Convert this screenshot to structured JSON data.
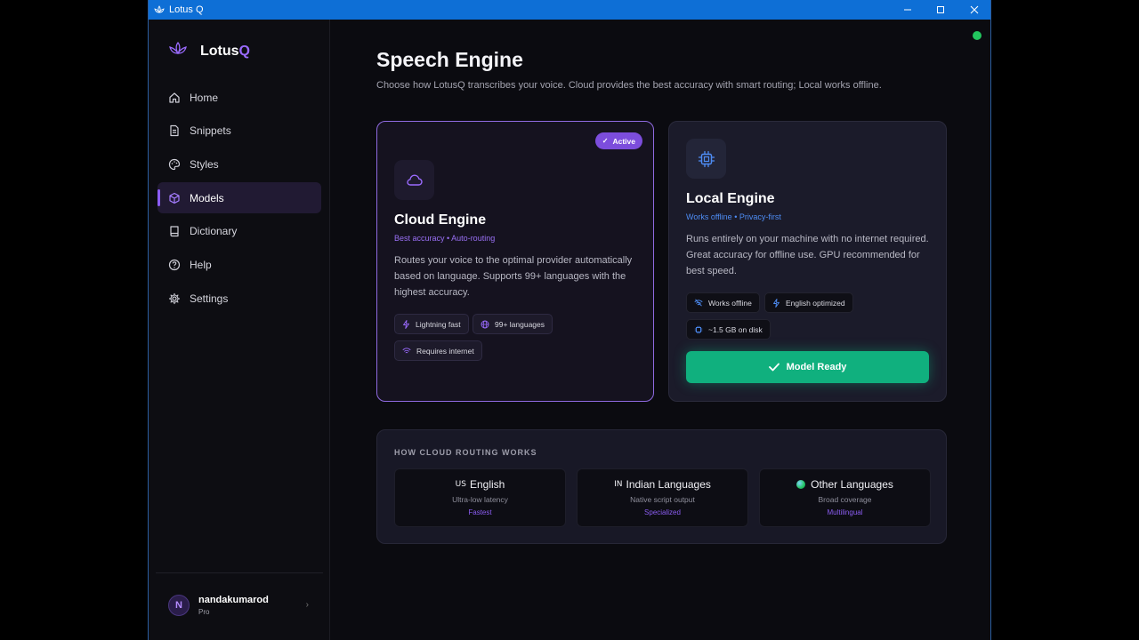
{
  "window": {
    "title": "Lotus Q",
    "controls": [
      "minimize",
      "maximize",
      "close"
    ]
  },
  "brand": {
    "name_main": "Lotus",
    "name_accent": "Q"
  },
  "sidebar": {
    "items": [
      {
        "label": "Home",
        "icon": "home-icon",
        "active": false
      },
      {
        "label": "Snippets",
        "icon": "document-icon",
        "active": false
      },
      {
        "label": "Styles",
        "icon": "palette-icon",
        "active": false
      },
      {
        "label": "Models",
        "icon": "cube-icon",
        "active": true
      },
      {
        "label": "Dictionary",
        "icon": "book-icon",
        "active": false
      },
      {
        "label": "Help",
        "icon": "help-icon",
        "active": false
      },
      {
        "label": "Settings",
        "icon": "gear-icon",
        "active": false
      }
    ]
  },
  "user": {
    "initial": "N",
    "name": "nandakumarod",
    "plan": "Pro"
  },
  "page": {
    "title": "Speech Engine",
    "subtitle": "Choose how LotusQ transcribes your voice. Cloud provides the best accuracy with smart routing; Local works offline."
  },
  "cloud": {
    "badge": "Active",
    "name": "Cloud Engine",
    "tagline": "Best accuracy • Auto-routing",
    "description": "Routes your voice to the optimal provider automatically based on language. Supports 99+ languages with the highest accuracy.",
    "chips": [
      "Lightning fast",
      "99+ languages",
      "Requires internet"
    ]
  },
  "local": {
    "name": "Local Engine",
    "tagline": "Works offline • Privacy-first",
    "description": "Runs entirely on your machine with no internet required. Great accuracy for offline use. GPU recommended for best speed.",
    "chips": [
      "Works offline",
      "English optimized",
      "~1.5 GB on disk"
    ],
    "button": "Model Ready"
  },
  "routing": {
    "title": "HOW CLOUD ROUTING WORKS",
    "cards": [
      {
        "flag": "US",
        "name": "English",
        "sub": "Ultra-low latency",
        "tag": "Fastest"
      },
      {
        "flag": "IN",
        "name": "Indian Languages",
        "sub": "Native script output",
        "tag": "Specialized"
      },
      {
        "flag": "",
        "name": "Other Languages",
        "sub": "Broad coverage",
        "tag": "Multilingual"
      }
    ]
  },
  "colors": {
    "accent": "#8b5cf6",
    "success": "#10b07e",
    "status": "#22c55e",
    "link_blue": "#4e8df5"
  }
}
